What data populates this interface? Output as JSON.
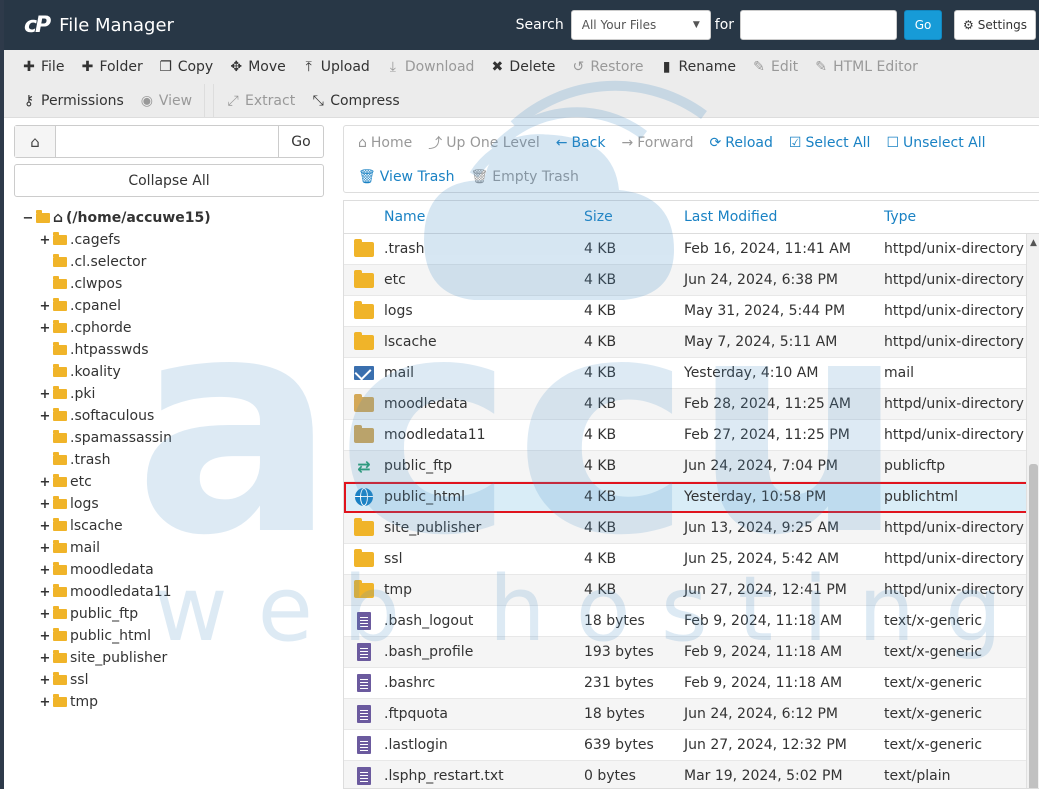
{
  "header": {
    "title": "File Manager",
    "search_label": "Search",
    "search_scope": "All Your Files",
    "for_label": "for",
    "go_label": "Go",
    "settings_label": "Settings"
  },
  "toolbar": {
    "row1": [
      {
        "icon": "plus-icon",
        "label": "File",
        "enabled": true
      },
      {
        "icon": "plus-icon",
        "label": "Folder",
        "enabled": true
      },
      {
        "icon": "copy-icon",
        "label": "Copy",
        "enabled": true
      },
      {
        "icon": "move-icon",
        "label": "Move",
        "enabled": true
      },
      {
        "icon": "upload-icon",
        "label": "Upload",
        "enabled": true
      },
      {
        "icon": "download-icon",
        "label": "Download",
        "enabled": false
      },
      {
        "icon": "delete-icon",
        "label": "Delete",
        "enabled": true
      },
      {
        "icon": "restore-icon",
        "label": "Restore",
        "enabled": false
      },
      {
        "icon": "rename-icon",
        "label": "Rename",
        "enabled": true
      },
      {
        "icon": "edit-icon",
        "label": "Edit",
        "enabled": false
      },
      {
        "icon": "html-editor-icon",
        "label": "HTML Editor",
        "enabled": false
      }
    ],
    "row2": [
      {
        "icon": "key-icon",
        "label": "Permissions",
        "enabled": true
      },
      {
        "icon": "eye-icon",
        "label": "View",
        "enabled": false
      },
      {
        "icon": "extract-icon",
        "label": "Extract",
        "enabled": false
      },
      {
        "icon": "compress-icon",
        "label": "Compress",
        "enabled": true
      }
    ]
  },
  "sidebar": {
    "go_label": "Go",
    "collapse_label": "Collapse All",
    "root_label": "(/home/accuwe15)",
    "items": [
      {
        "label": ".cagefs",
        "expandable": true
      },
      {
        "label": ".cl.selector",
        "expandable": false
      },
      {
        "label": ".clwpos",
        "expandable": false
      },
      {
        "label": ".cpanel",
        "expandable": true
      },
      {
        "label": ".cphorde",
        "expandable": true
      },
      {
        "label": ".htpasswds",
        "expandable": false
      },
      {
        "label": ".koality",
        "expandable": false
      },
      {
        "label": ".pki",
        "expandable": true
      },
      {
        "label": ".softaculous",
        "expandable": true
      },
      {
        "label": ".spamassassin",
        "expandable": false
      },
      {
        "label": ".trash",
        "expandable": false
      },
      {
        "label": "etc",
        "expandable": true
      },
      {
        "label": "logs",
        "expandable": true
      },
      {
        "label": "lscache",
        "expandable": true
      },
      {
        "label": "mail",
        "expandable": true
      },
      {
        "label": "moodledata",
        "expandable": true
      },
      {
        "label": "moodledata11",
        "expandable": true
      },
      {
        "label": "public_ftp",
        "expandable": true
      },
      {
        "label": "public_html",
        "expandable": true
      },
      {
        "label": "site_publisher",
        "expandable": true
      },
      {
        "label": "ssl",
        "expandable": true
      },
      {
        "label": "tmp",
        "expandable": true
      }
    ]
  },
  "nav": {
    "row1": [
      {
        "icon": "home-icon",
        "label": "Home",
        "enabled": false
      },
      {
        "icon": "up-level-icon",
        "label": "Up One Level",
        "enabled": false
      },
      {
        "icon": "back-icon",
        "label": "Back",
        "enabled": true
      },
      {
        "icon": "forward-icon",
        "label": "Forward",
        "enabled": false
      },
      {
        "icon": "reload-icon",
        "label": "Reload",
        "enabled": true
      },
      {
        "icon": "select-all-icon",
        "label": "Select All",
        "enabled": true
      },
      {
        "icon": "unselect-all-icon",
        "label": "Unselect All",
        "enabled": true
      }
    ],
    "row2": [
      {
        "icon": "trash-icon",
        "label": "View Trash",
        "enabled": true
      },
      {
        "icon": "trash-icon",
        "label": "Empty Trash",
        "enabled": false
      }
    ]
  },
  "table": {
    "headers": {
      "name": "Name",
      "size": "Size",
      "modified": "Last Modified",
      "type": "Type"
    },
    "rows": [
      {
        "icon": "folder",
        "name": ".trash",
        "size": "4 KB",
        "modified": "Feb 16, 2024, 11:41 AM",
        "type": "httpd/unix-directory"
      },
      {
        "icon": "folder",
        "name": "etc",
        "size": "4 KB",
        "modified": "Jun 24, 2024, 6:38 PM",
        "type": "httpd/unix-directory"
      },
      {
        "icon": "folder",
        "name": "logs",
        "size": "4 KB",
        "modified": "May 31, 2024, 5:44 PM",
        "type": "httpd/unix-directory"
      },
      {
        "icon": "folder",
        "name": "lscache",
        "size": "4 KB",
        "modified": "May 7, 2024, 5:11 AM",
        "type": "httpd/unix-directory"
      },
      {
        "icon": "mail",
        "name": "mail",
        "size": "4 KB",
        "modified": "Yesterday, 4:10 AM",
        "type": "mail"
      },
      {
        "icon": "folder-tan",
        "name": "moodledata",
        "size": "4 KB",
        "modified": "Feb 28, 2024, 11:25 AM",
        "type": "httpd/unix-directory"
      },
      {
        "icon": "folder-tan",
        "name": "moodledata11",
        "size": "4 KB",
        "modified": "Feb 27, 2024, 11:25 PM",
        "type": "httpd/unix-directory"
      },
      {
        "icon": "ftp",
        "name": "public_ftp",
        "size": "4 KB",
        "modified": "Jun 24, 2024, 7:04 PM",
        "type": "publicftp"
      },
      {
        "icon": "globe",
        "name": "public_html",
        "size": "4 KB",
        "modified": "Yesterday, 10:58 PM",
        "type": "publichtml",
        "selected": true
      },
      {
        "icon": "folder",
        "name": "site_publisher",
        "size": "4 KB",
        "modified": "Jun 13, 2024, 9:25 AM",
        "type": "httpd/unix-directory"
      },
      {
        "icon": "folder",
        "name": "ssl",
        "size": "4 KB",
        "modified": "Jun 25, 2024, 5:42 AM",
        "type": "httpd/unix-directory"
      },
      {
        "icon": "folder",
        "name": "tmp",
        "size": "4 KB",
        "modified": "Jun 27, 2024, 12:41 PM",
        "type": "httpd/unix-directory"
      },
      {
        "icon": "file",
        "name": ".bash_logout",
        "size": "18 bytes",
        "modified": "Feb 9, 2024, 11:18 AM",
        "type": "text/x-generic"
      },
      {
        "icon": "file",
        "name": ".bash_profile",
        "size": "193 bytes",
        "modified": "Feb 9, 2024, 11:18 AM",
        "type": "text/x-generic"
      },
      {
        "icon": "file",
        "name": ".bashrc",
        "size": "231 bytes",
        "modified": "Feb 9, 2024, 11:18 AM",
        "type": "text/x-generic"
      },
      {
        "icon": "file",
        "name": ".ftpquota",
        "size": "18 bytes",
        "modified": "Jun 24, 2024, 6:12 PM",
        "type": "text/x-generic"
      },
      {
        "icon": "file",
        "name": ".lastlogin",
        "size": "639 bytes",
        "modified": "Jun 27, 2024, 12:32 PM",
        "type": "text/x-generic"
      },
      {
        "icon": "file",
        "name": ".lsphp_restart.txt",
        "size": "0 bytes",
        "modified": "Mar 19, 2024, 5:02 PM",
        "type": "text/plain"
      }
    ]
  },
  "watermark": {
    "brand": "accu",
    "tagline": "web hosting"
  }
}
